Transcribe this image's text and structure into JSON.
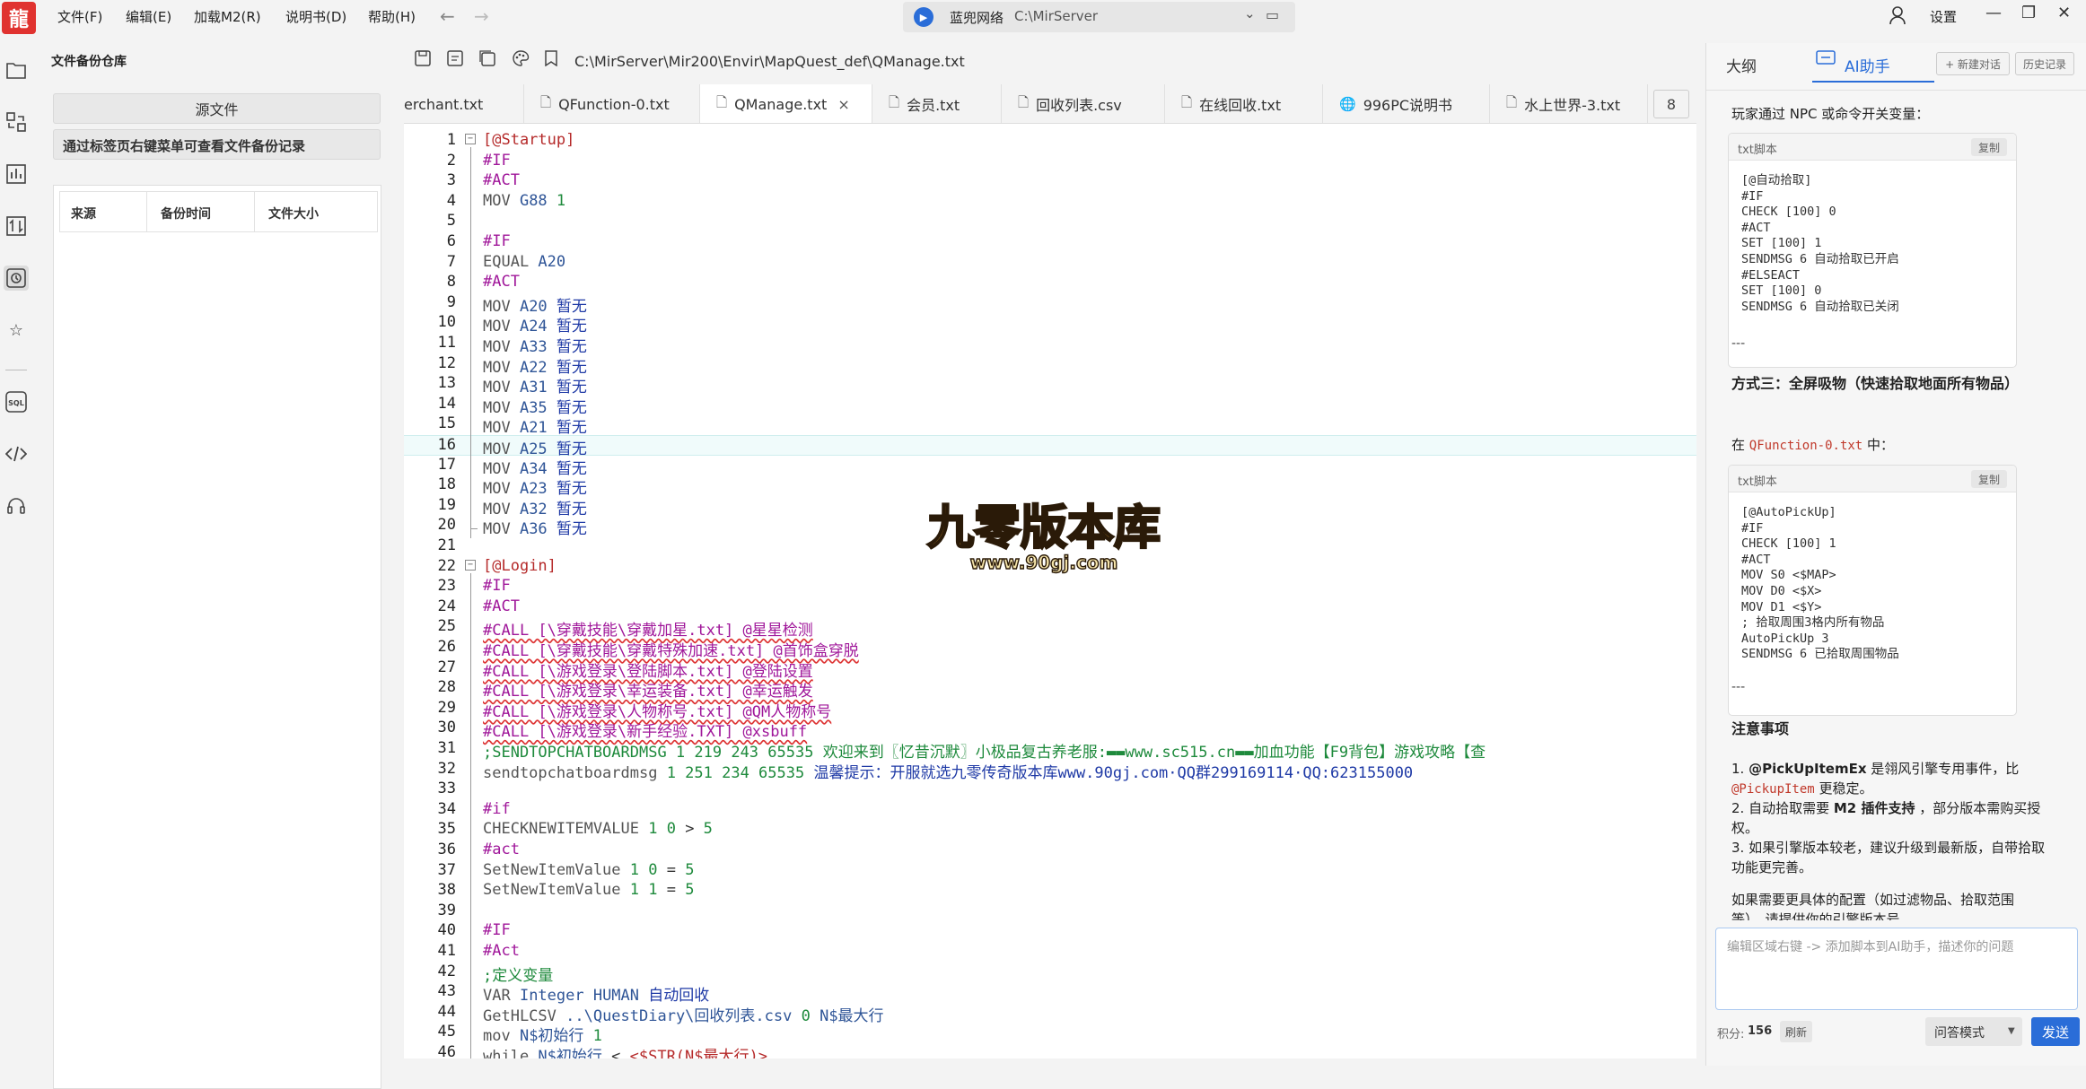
{
  "app": {
    "logo_char": "龍"
  },
  "menu": {
    "items": [
      "文件(F)",
      "编辑(E)",
      "加载M2(R)",
      "说明书(D)",
      "帮助(H)"
    ],
    "back": "←",
    "forward": "→"
  },
  "project": {
    "name": "蓝兜网络",
    "path": "C:\\MirServer"
  },
  "window": {
    "settings": "设置",
    "minimize": "—",
    "maximize": "❐",
    "close": "✕"
  },
  "backup_panel": {
    "title": "文件备份仓库",
    "source_button": "源文件",
    "hint": "通过标签页右键菜单可查看文件备份记录",
    "columns": [
      "来源",
      "备份时间",
      "文件大小"
    ]
  },
  "editor": {
    "file_path": "C:\\MirServer\\Mir200\\Envir\\MapQuest_def\\QManage.txt",
    "tabs": [
      {
        "label": "erchant.txt",
        "active": false,
        "icon": "file-icon"
      },
      {
        "label": "QFunction-0.txt",
        "active": false,
        "icon": "file-icon"
      },
      {
        "label": "QManage.txt",
        "active": true,
        "icon": "file-icon",
        "close": "×"
      },
      {
        "label": "会员.txt",
        "active": false,
        "icon": "file-icon"
      },
      {
        "label": "回收列表.csv",
        "active": false,
        "icon": "file-icon"
      },
      {
        "label": "在线回收.txt",
        "active": false,
        "icon": "file-icon"
      },
      {
        "label": "996PC说明书",
        "active": false,
        "icon": "globe-icon"
      },
      {
        "label": "水上世界-3.txt",
        "active": false,
        "icon": "file-icon"
      }
    ],
    "tab_count": "8",
    "highlighted_line": 16,
    "lines": [
      {
        "n": "1",
        "fold": "−",
        "parts": [
          [
            "c-section",
            "[@Startup]"
          ]
        ]
      },
      {
        "n": "2",
        "parts": [
          [
            "c-kw",
            "#IF"
          ]
        ]
      },
      {
        "n": "3",
        "parts": [
          [
            "c-kw",
            "#ACT"
          ]
        ]
      },
      {
        "n": "4",
        "parts": [
          [
            "c-cmd",
            "MOV "
          ],
          [
            "c-var",
            "G88 "
          ],
          [
            "c-num",
            "1"
          ]
        ]
      },
      {
        "n": "5",
        "parts": []
      },
      {
        "n": "6",
        "parts": [
          [
            "c-kw",
            "#IF"
          ]
        ]
      },
      {
        "n": "7",
        "parts": [
          [
            "c-cmd",
            "EQUAL "
          ],
          [
            "c-var",
            "A20"
          ]
        ]
      },
      {
        "n": "8",
        "parts": [
          [
            "c-kw",
            "#ACT"
          ]
        ]
      },
      {
        "n": "9",
        "parts": [
          [
            "c-cmd",
            "MOV "
          ],
          [
            "c-var",
            "A20 "
          ],
          [
            "c-cn",
            "暂无"
          ]
        ]
      },
      {
        "n": "10",
        "parts": [
          [
            "c-cmd",
            "MOV "
          ],
          [
            "c-var",
            "A24 "
          ],
          [
            "c-cn",
            "暂无"
          ]
        ]
      },
      {
        "n": "11",
        "parts": [
          [
            "c-cmd",
            "MOV "
          ],
          [
            "c-var",
            "A33 "
          ],
          [
            "c-cn",
            "暂无"
          ]
        ]
      },
      {
        "n": "12",
        "parts": [
          [
            "c-cmd",
            "MOV "
          ],
          [
            "c-var",
            "A22 "
          ],
          [
            "c-cn",
            "暂无"
          ]
        ]
      },
      {
        "n": "13",
        "parts": [
          [
            "c-cmd",
            "MOV "
          ],
          [
            "c-var",
            "A31 "
          ],
          [
            "c-cn",
            "暂无"
          ]
        ]
      },
      {
        "n": "14",
        "parts": [
          [
            "c-cmd",
            "MOV "
          ],
          [
            "c-var",
            "A35 "
          ],
          [
            "c-cn",
            "暂无"
          ]
        ]
      },
      {
        "n": "15",
        "parts": [
          [
            "c-cmd",
            "MOV "
          ],
          [
            "c-var",
            "A21 "
          ],
          [
            "c-cn",
            "暂无"
          ]
        ]
      },
      {
        "n": "16",
        "parts": [
          [
            "c-cmd",
            "MOV "
          ],
          [
            "c-var",
            "A25 "
          ],
          [
            "c-cn",
            "暂无"
          ]
        ]
      },
      {
        "n": "17",
        "parts": [
          [
            "c-cmd",
            "MOV "
          ],
          [
            "c-var",
            "A34 "
          ],
          [
            "c-cn",
            "暂无"
          ]
        ]
      },
      {
        "n": "18",
        "parts": [
          [
            "c-cmd",
            "MOV "
          ],
          [
            "c-var",
            "A23 "
          ],
          [
            "c-cn",
            "暂无"
          ]
        ]
      },
      {
        "n": "19",
        "parts": [
          [
            "c-cmd",
            "MOV "
          ],
          [
            "c-var",
            "A32 "
          ],
          [
            "c-cn",
            "暂无"
          ]
        ]
      },
      {
        "n": "20",
        "parts": [
          [
            "c-cmd",
            "MOV "
          ],
          [
            "c-var",
            "A36 "
          ],
          [
            "c-cn",
            "暂无"
          ]
        ]
      },
      {
        "n": "21",
        "parts": []
      },
      {
        "n": "22",
        "fold": "−",
        "parts": [
          [
            "c-section",
            "[@Login]"
          ]
        ]
      },
      {
        "n": "23",
        "parts": [
          [
            "c-kw",
            "#IF"
          ]
        ]
      },
      {
        "n": "24",
        "parts": [
          [
            "c-kw",
            "#ACT"
          ]
        ]
      },
      {
        "n": "25",
        "parts": [
          [
            "c-call",
            "#CALL [\\穿戴技能\\穿戴加星.txt] @星星检测"
          ]
        ]
      },
      {
        "n": "26",
        "parts": [
          [
            "c-call",
            "#CALL [\\穿戴技能\\穿戴特殊加速.txt] @首饰盒穿脱"
          ]
        ]
      },
      {
        "n": "27",
        "parts": [
          [
            "c-call",
            "#CALL [\\游戏登录\\登陆脚本.txt] @登陆设置"
          ]
        ]
      },
      {
        "n": "28",
        "parts": [
          [
            "c-call",
            "#CALL [\\游戏登录\\幸运装备.txt] @幸运触发"
          ]
        ]
      },
      {
        "n": "29",
        "parts": [
          [
            "c-call",
            "#CALL [\\游戏登录\\人物称号.txt] @QM人物称号"
          ]
        ]
      },
      {
        "n": "30",
        "parts": [
          [
            "c-call",
            "#CALL [\\游戏登录\\新手经验.TXT] @xsbuff"
          ]
        ]
      },
      {
        "n": "31",
        "parts": [
          [
            "c-green",
            ";SENDTOPCHATBOARDMSG 1 219 243 65535 欢迎来到〖忆昔沉默〗小极品复古养老服:▬▬www.sc515.cn▬▬加血功能【F9背包】游戏攻略【查"
          ]
        ]
      },
      {
        "n": "32",
        "parts": [
          [
            "c-cmd",
            "sendtopchatboardmsg "
          ],
          [
            "c-num",
            "1 251 234 65535 "
          ],
          [
            "c-cn",
            "温馨提示：开服就选九零传奇版本库www.90gj.com·QQ群299169114·QQ:623155000"
          ]
        ]
      },
      {
        "n": "33",
        "parts": []
      },
      {
        "n": "34",
        "parts": [
          [
            "c-kw",
            "#if"
          ]
        ]
      },
      {
        "n": "35",
        "parts": [
          [
            "c-cmd",
            "CHECKNEWITEMVALUE "
          ],
          [
            "c-num",
            "1 0 "
          ],
          [
            "c-plain",
            "> "
          ],
          [
            "c-num",
            "5"
          ]
        ]
      },
      {
        "n": "36",
        "parts": [
          [
            "c-kw",
            "#act"
          ]
        ]
      },
      {
        "n": "37",
        "parts": [
          [
            "c-cmd",
            "SetNewItemValue "
          ],
          [
            "c-num",
            "1 0 "
          ],
          [
            "c-plain",
            "= "
          ],
          [
            "c-num",
            "5"
          ]
        ]
      },
      {
        "n": "38",
        "parts": [
          [
            "c-cmd",
            "SetNewItemValue "
          ],
          [
            "c-num",
            "1 1 "
          ],
          [
            "c-plain",
            "= "
          ],
          [
            "c-num",
            "5"
          ]
        ]
      },
      {
        "n": "39",
        "parts": []
      },
      {
        "n": "40",
        "parts": [
          [
            "c-kw",
            "#IF"
          ]
        ]
      },
      {
        "n": "41",
        "parts": [
          [
            "c-kw",
            "#Act"
          ]
        ]
      },
      {
        "n": "42",
        "parts": [
          [
            "c-green",
            ";定义变量"
          ]
        ]
      },
      {
        "n": "43",
        "parts": [
          [
            "c-cmd",
            "VAR "
          ],
          [
            "c-var",
            "Integer HUMAN "
          ],
          [
            "c-cn",
            "自动回收"
          ]
        ]
      },
      {
        "n": "44",
        "parts": [
          [
            "c-cmd",
            "GetHLCSV "
          ],
          [
            "c-var",
            "..\\QuestDiary\\回收列表.csv "
          ],
          [
            "c-num",
            "0 "
          ],
          [
            "c-var",
            "N$最大行"
          ]
        ]
      },
      {
        "n": "45",
        "parts": [
          [
            "c-cmd",
            "mov "
          ],
          [
            "c-var",
            "N$初始行 "
          ],
          [
            "c-num",
            "1"
          ]
        ]
      },
      {
        "n": "46",
        "parts": [
          [
            "c-cmd",
            "while "
          ],
          [
            "c-var",
            "N$初始行 "
          ],
          [
            "c-plain",
            "< "
          ],
          [
            "c-section",
            "<$STR(N$最大行)>"
          ]
        ]
      }
    ]
  },
  "watermark": {
    "text": "九零版本库",
    "url": "www.90gj.com"
  },
  "ai_panel": {
    "tab_outline": "大纲",
    "tab_assistant": "AI助手",
    "new_chat": "+ 新建对话",
    "history": "历史记录",
    "intro": "玩家通过 NPC 或命令开关变量：",
    "card1": {
      "lang": "txt脚本",
      "copy": "复制",
      "code": "[@自动拾取]\n#IF\nCHECK [100] 0\n#ACT\nSET [100] 1\nSENDMSG 6 自动拾取已开启\n#ELSEACT\nSET [100] 0\nSENDMSG 6 自动拾取已关闭"
    },
    "sep1": "---",
    "method3": "方式三：全屏吸物（快速拾取地面所有物品）",
    "in_prefix": "在",
    "in_file": "QFunction-0.txt",
    "in_suffix": "中：",
    "card2": {
      "lang": "txt脚本",
      "copy": "复制",
      "code": "[@AutoPickUp]\n#IF\nCHECK [100] 1\n#ACT\nMOV S0 <$MAP>\nMOV D0 <$X>\nMOV D1 <$Y>\n; 拾取周围3格内所有物品\nAutoPickUp 3\nSENDMSG 6 已拾取周围物品"
    },
    "sep2": "---",
    "notes_title": "注意事项",
    "note1_num": "1.",
    "note1_bold": "@PickUpItemEx",
    "note1_text": "是翎风引擎专用事件，比",
    "note1_code": "@PickupItem",
    "note1_tail": "更稳定。",
    "note2_num": "2. 自动拾取需要",
    "note2_bold": "M2 插件支持",
    "note2_tail": "，部分版本需购买授权。",
    "note3": "3. 如果引擎版本较老，建议升级到最新版，自带拾取功能更完善。",
    "more": "如果需要更具体的配置（如过滤物品、拾取范围等），请提供你的引擎版本号。",
    "input_placeholder": "编辑区域右键 -> 添加脚本到AI助手，描述你的问题",
    "points_label": "积分:",
    "points_value": "156",
    "refresh": "刷新",
    "mode": "问答模式",
    "send": "发送"
  }
}
